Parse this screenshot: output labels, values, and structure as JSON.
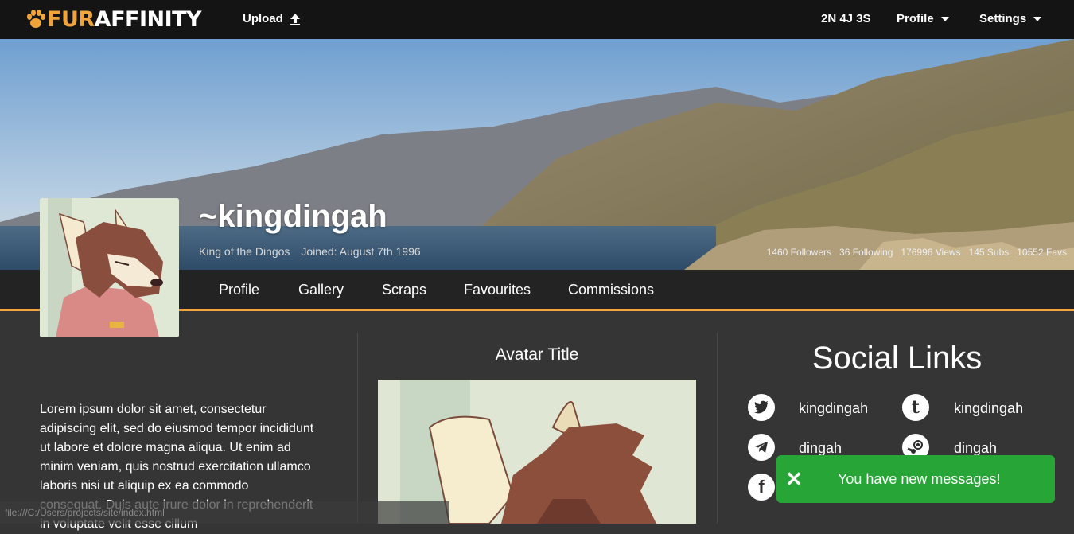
{
  "brand": {
    "fur": "FUR",
    "affinity": "AFFINITY",
    "accent": "#f1a43a"
  },
  "topnav": {
    "upload": "Upload",
    "notifications": "2N 4J 3S",
    "profile": "Profile",
    "settings": "Settings"
  },
  "profile": {
    "username": "~kingdingah",
    "title": "King of the Dingos",
    "joined": "Joined: August 7th 1996",
    "stats": [
      "1460 Followers",
      "36 Following",
      "176996 Views",
      "145 Subs",
      "10552 Favs"
    ]
  },
  "tabs": [
    "Profile",
    "Gallery",
    "Scraps",
    "Favourites",
    "Commissions"
  ],
  "bio": "Lorem ipsum dolor sit amet, consectetur adipiscing elit, sed do eiusmod tempor incididunt ut labore et dolore magna aliqua. Ut enim ad minim veniam, quis nostrud exercitation ullamco laboris nisi ut aliquip ex ea commodo consequat. Duis aute irure dolor in reprehenderit in voluptate velit esse cillum",
  "avatar_title": "Avatar Title",
  "social": {
    "title": "Social Links",
    "links": [
      {
        "icon": "twitter-icon",
        "label": "kingdingah"
      },
      {
        "icon": "tumblr-icon",
        "label": "kingdingah"
      },
      {
        "icon": "telegram-icon",
        "label": "dingah"
      },
      {
        "icon": "steam-icon",
        "label": "dingah"
      },
      {
        "icon": "facebook-icon",
        "label": ""
      }
    ]
  },
  "toast": {
    "message": "You have new messages!",
    "color": "#27a637"
  },
  "statusbar": "file:///C:/Users/projects/site/index.html"
}
